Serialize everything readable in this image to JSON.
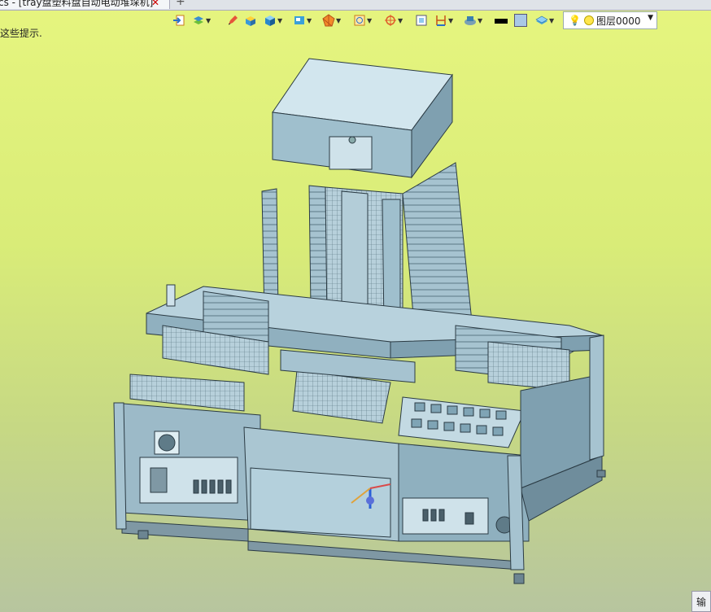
{
  "tab": {
    "title": "cs - [tray盘塑料盘自动电动堆垛机]",
    "close_glyph": "✕",
    "new_glyph": "+"
  },
  "hint_text": "这些提示.",
  "toolbar": {
    "icons": [
      "import-icon",
      "layers-arrow-icon",
      "pen-icon",
      "box-paint-icon",
      "solid-box-icon",
      "cube-view-icon",
      "polygon-icon",
      "frame-icon",
      "crosshair-icon",
      "select-icon",
      "dimension-icon",
      "render-icon"
    ],
    "line_swatch": "#000000",
    "fill_swatch": "#a9c8e6",
    "layer_label": "图层0000",
    "dropdown_glyph": "▼"
  },
  "corner_label": "输",
  "colors": {
    "bg_top": "#e6f57f",
    "bg_bottom": "#b7c59f",
    "metal": "#a8c8d6",
    "metal_dark": "#6f8d9c",
    "metal_light": "#d2e6ee",
    "line": "#2b3b44"
  }
}
